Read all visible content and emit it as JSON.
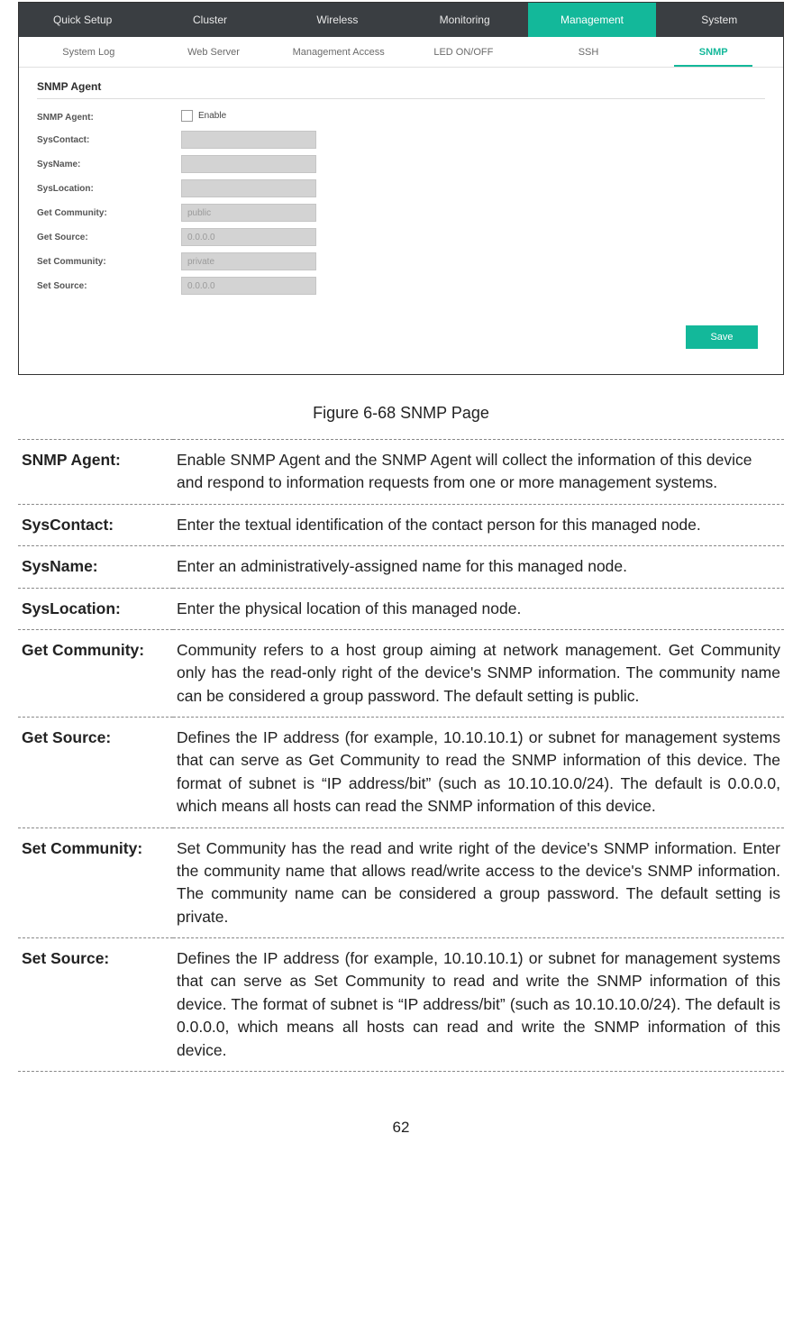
{
  "primaryNav": {
    "items": [
      "Quick Setup",
      "Cluster",
      "Wireless",
      "Monitoring",
      "Management",
      "System"
    ],
    "activeIndex": 4
  },
  "secondaryNav": {
    "items": [
      "System Log",
      "Web Server",
      "Management Access",
      "LED ON/OFF",
      "SSH",
      "SNMP"
    ],
    "activeIndex": 5
  },
  "panel": {
    "title": "SNMP Agent",
    "fields": {
      "snmpAgentLabel": "SNMP Agent:",
      "enableLabel": "Enable",
      "sysContactLabel": "SysContact:",
      "sysContactValue": "",
      "sysNameLabel": "SysName:",
      "sysNameValue": "",
      "sysLocationLabel": "SysLocation:",
      "sysLocationValue": "",
      "getCommunityLabel": "Get Community:",
      "getCommunityValue": "public",
      "getSourceLabel": "Get Source:",
      "getSourceValue": "0.0.0.0",
      "setCommunityLabel": "Set Community:",
      "setCommunityValue": "private",
      "setSourceLabel": "Set Source:",
      "setSourceValue": "0.0.0.0"
    },
    "saveLabel": "Save"
  },
  "caption": "Figure 6-68 SNMP Page",
  "descriptions": [
    {
      "term": "SNMP Agent:",
      "def": "Enable SNMP Agent and the SNMP Agent will collect the information of this device and respond to information requests from one or more management systems.",
      "justify": false
    },
    {
      "term": "SysContact:",
      "def": "Enter the textual identification of the contact person for this managed node.",
      "justify": false
    },
    {
      "term": "SysName:",
      "def": "Enter an administratively-assigned name for this managed node.",
      "justify": false
    },
    {
      "term": "SysLocation:",
      "def": "Enter the physical location of this managed node.",
      "justify": false
    },
    {
      "term": "Get Community:",
      "def": "Community refers to a host group aiming at network management. Get Community only has the read-only right of the device's SNMP information. The community name can be considered a group password. The default setting is public.",
      "justify": true
    },
    {
      "term": "Get Source:",
      "def": "Defines the IP address (for example, 10.10.10.1) or subnet for management systems that can serve as Get Community to read the SNMP information of this device. The format of subnet is “IP address/bit” (such as 10.10.10.0/24). The default is 0.0.0.0, which means all hosts can read the SNMP information of this device.",
      "justify": true
    },
    {
      "term": "Set Community:",
      "def": "Set Community has the read and write right of the device's SNMP information. Enter the community name that allows read/write access to the device's SNMP information. The community name can be considered a group password. The default setting is private.",
      "justify": true
    },
    {
      "term": "Set Source:",
      "def": "Defines the IP address (for example, 10.10.10.1) or subnet for management systems that can serve as Set Community to read and write the SNMP information of this device. The format of subnet is “IP address/bit” (such as 10.10.10.0/24). The default is 0.0.0.0, which means all hosts can read and write the SNMP information of this device.",
      "justify": true
    }
  ],
  "pageNumber": "62"
}
